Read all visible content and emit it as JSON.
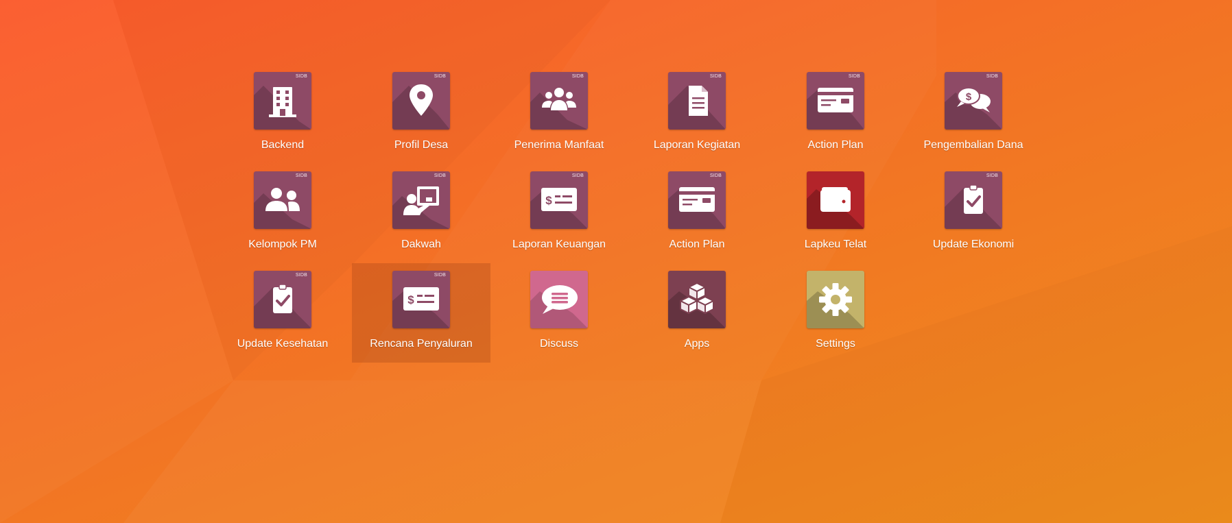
{
  "apps": [
    {
      "name": "Backend",
      "icon": "building-icon",
      "badge": "SIDB",
      "color": "#8e4a66"
    },
    {
      "name": "Profil Desa",
      "icon": "map-marker-icon",
      "badge": "SIDB",
      "color": "#8e4a66"
    },
    {
      "name": "Penerima Manfaat",
      "icon": "users-icon",
      "badge": "SIDB",
      "color": "#8e4a66"
    },
    {
      "name": "Laporan Kegiatan",
      "icon": "document-icon",
      "badge": "SIDB",
      "color": "#8e4a66"
    },
    {
      "name": "Action Plan",
      "icon": "card-icon",
      "badge": "SIDB",
      "color": "#8e4a66"
    },
    {
      "name": "Pengembalian Dana",
      "icon": "money-chat-icon",
      "badge": "SIDB",
      "color": "#8e4a66"
    },
    {
      "name": "Kelompok PM",
      "icon": "user-group-icon",
      "badge": "SIDB",
      "color": "#8e4a66"
    },
    {
      "name": "Dakwah",
      "icon": "presentation-icon",
      "badge": "SIDB",
      "color": "#8e4a66"
    },
    {
      "name": "Laporan Keuangan",
      "icon": "money-check-icon",
      "badge": "SIDB",
      "color": "#8e4a66"
    },
    {
      "name": "Action Plan",
      "icon": "card-icon",
      "badge": "SIDB",
      "color": "#8e4a66"
    },
    {
      "name": "Lapkeu Telat",
      "icon": "wallet-icon",
      "badge": "",
      "color": "#b3242a"
    },
    {
      "name": "Update Ekonomi",
      "icon": "clipboard-check-icon",
      "badge": "SIDB",
      "color": "#8e4a66"
    },
    {
      "name": "Update Kesehatan",
      "icon": "clipboard-check-icon",
      "badge": "SIDB",
      "color": "#8e4a66"
    },
    {
      "name": "Rencana Penyaluran",
      "icon": "money-check-icon",
      "badge": "SIDB",
      "color": "#8e4a66",
      "selected": true
    },
    {
      "name": "Discuss",
      "icon": "chat-bubble-icon",
      "badge": "",
      "color": "#d0688e"
    },
    {
      "name": "Apps",
      "icon": "cubes-icon",
      "badge": "",
      "color": "#7d4051"
    },
    {
      "name": "Settings",
      "icon": "gear-icon",
      "badge": "",
      "color": "#c3b36a"
    }
  ]
}
